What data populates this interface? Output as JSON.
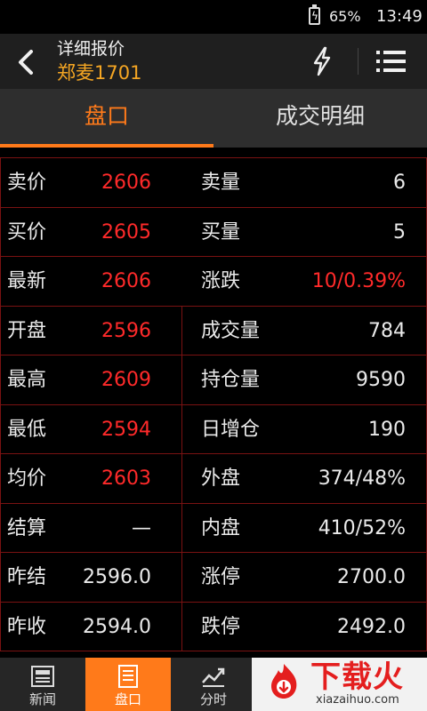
{
  "status_bar": {
    "battery_pct": "65%",
    "time": "13:49"
  },
  "header": {
    "title": "详细报价",
    "subtitle": "郑麦1701",
    "icons": {
      "back": "chevron-left-icon",
      "flash": "lightning-icon",
      "menu": "list-menu-icon"
    }
  },
  "tabs": [
    {
      "label": "盘口",
      "active": true
    },
    {
      "label": "成交明细",
      "active": false
    }
  ],
  "quote_rows": [
    {
      "label1": "卖价",
      "value1": "2606",
      "label2": "卖量",
      "value2": "6"
    },
    {
      "label1": "买价",
      "value1": "2605",
      "label2": "买量",
      "value2": "5"
    },
    {
      "label1": "最新",
      "value1": "2606",
      "label2": "涨跌",
      "value2": "10/0.39%"
    },
    {
      "label1": "开盘",
      "value1": "2596",
      "label2": "成交量",
      "value2": "784"
    },
    {
      "label1": "最高",
      "value1": "2609",
      "label2": "持仓量",
      "value2": "9590"
    },
    {
      "label1": "最低",
      "value1": "2594",
      "label2": "日增仓",
      "value2": "190"
    },
    {
      "label1": "均价",
      "value1": "2603",
      "label2": "外盘",
      "value2": "374/48%"
    },
    {
      "label1": "结算",
      "value1": "—",
      "label2": "内盘",
      "value2": "410/52%"
    },
    {
      "label1": "昨结",
      "value1": "2596.0",
      "label2": "涨停",
      "value2": "2700.0"
    },
    {
      "label1": "昨收",
      "value1": "2594.0",
      "label2": "跌停",
      "value2": "2492.0"
    }
  ],
  "colors": {
    "accent": "#ff7a1a",
    "price_red": "#ff2a2a",
    "grid_line": "#7a1212",
    "title_gold": "#f5a623"
  },
  "bottom_nav": [
    {
      "label": "新闻",
      "icon": "newspaper-icon",
      "active": false
    },
    {
      "label": "盘口",
      "icon": "document-icon",
      "active": true
    },
    {
      "label": "分时",
      "icon": "line-chart-icon",
      "active": false
    }
  ],
  "watermark": {
    "title": "下载火",
    "url": "xiazaihuo.com"
  }
}
